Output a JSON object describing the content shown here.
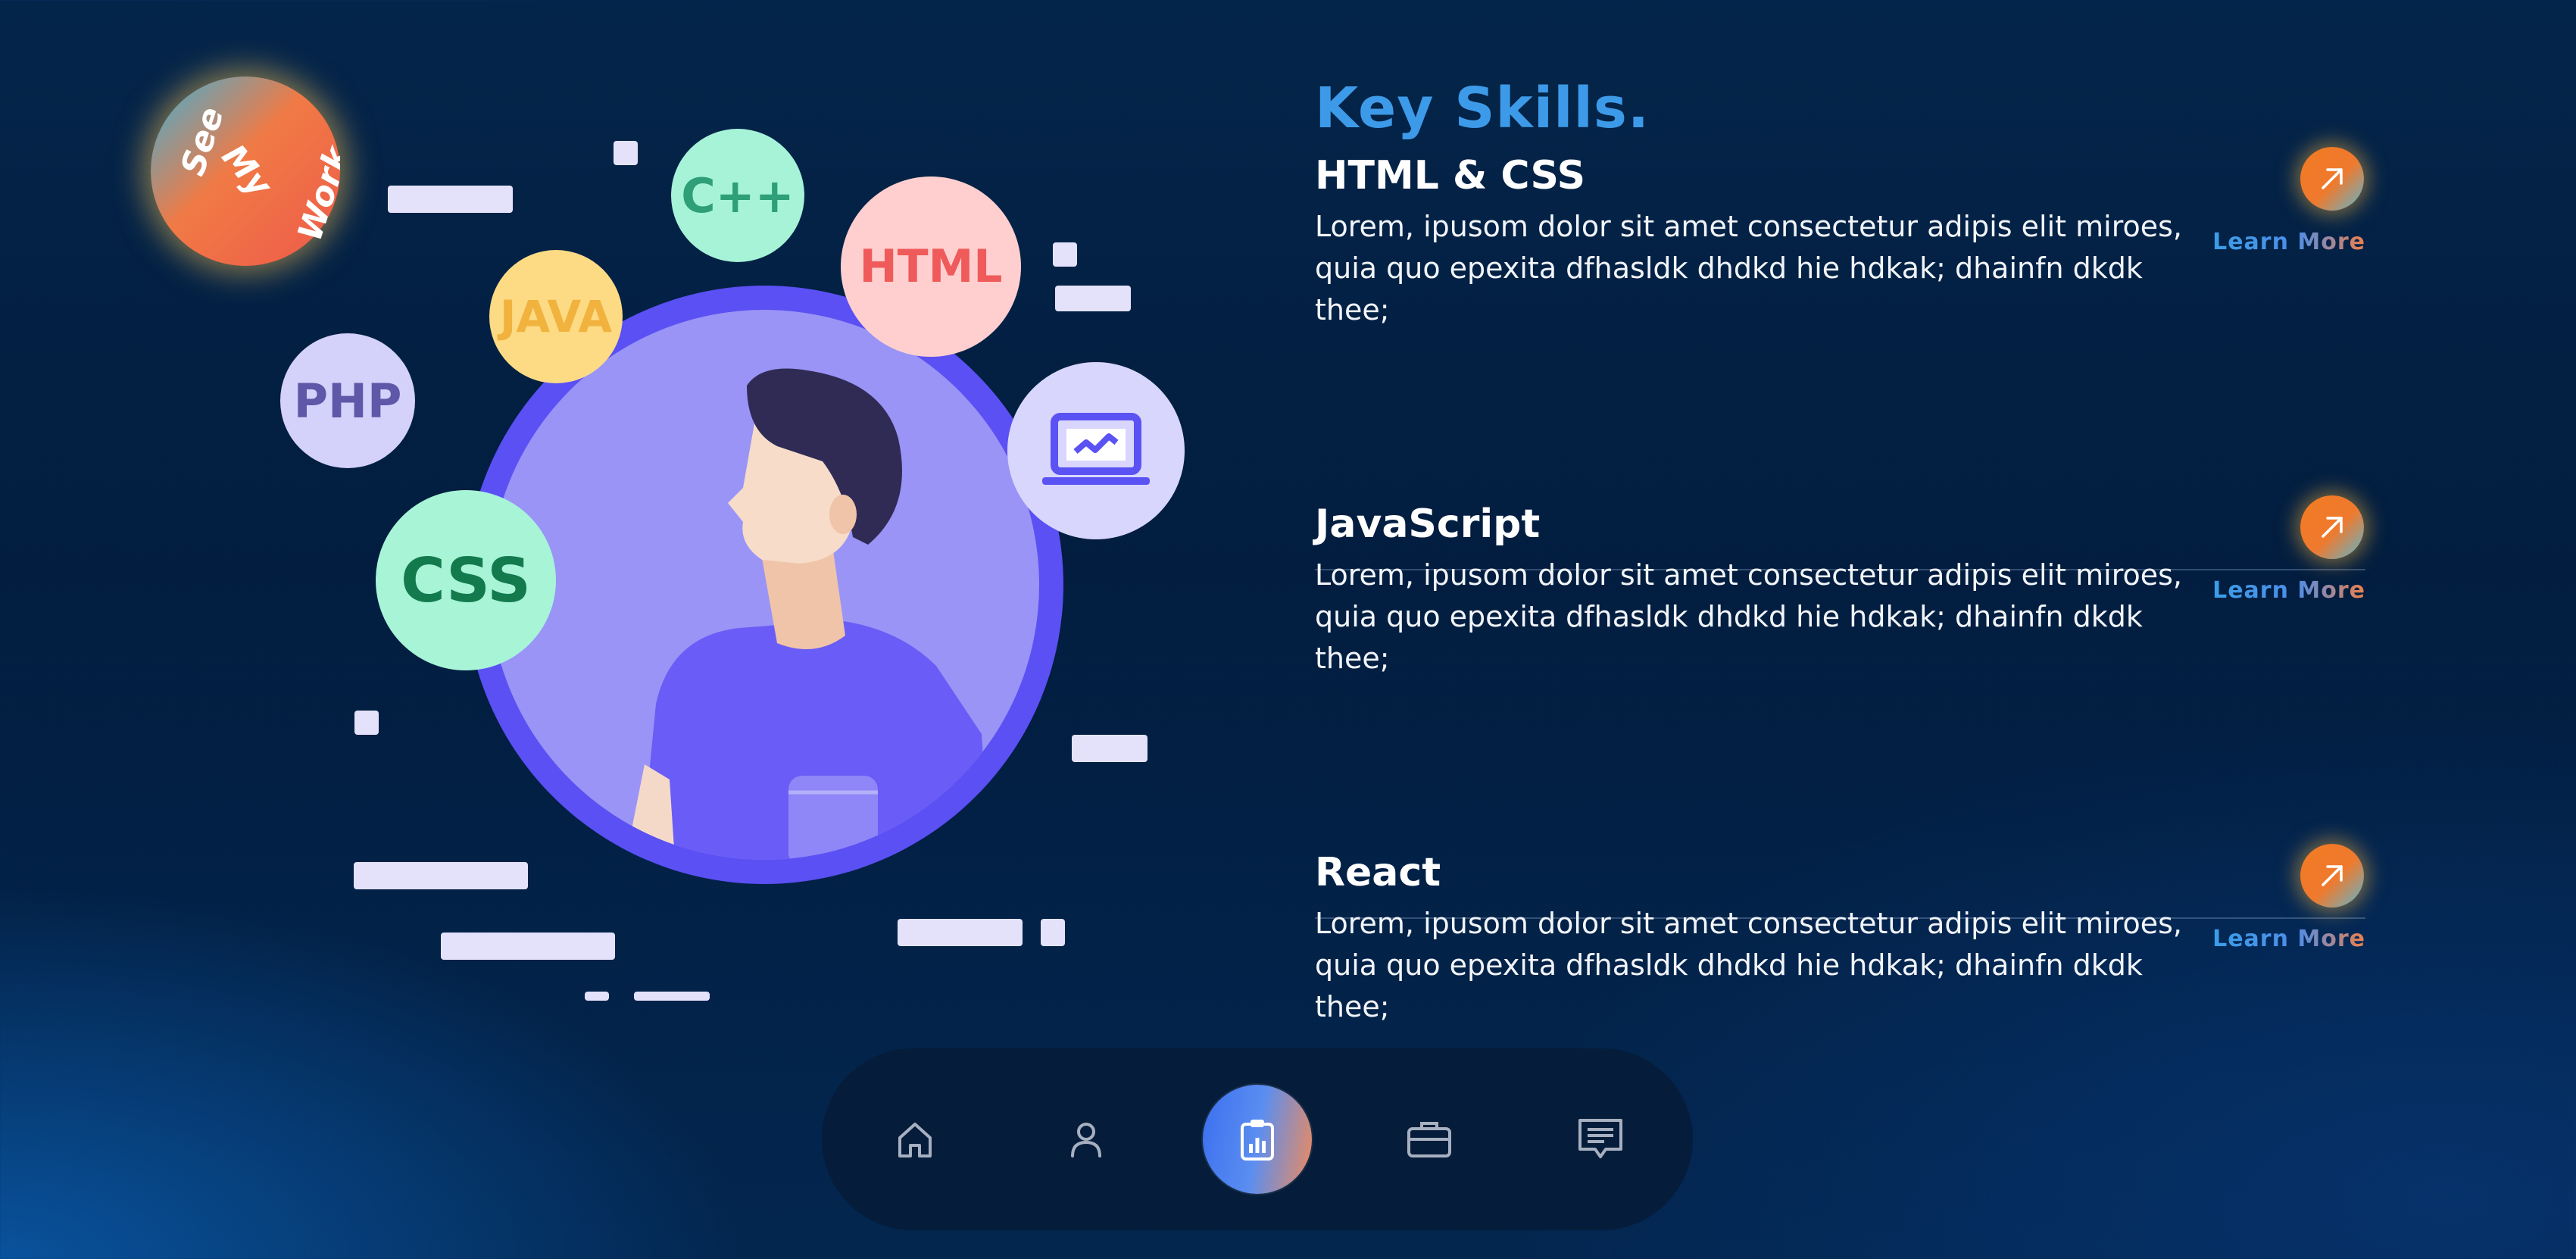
{
  "badge": {
    "lines": [
      "See",
      "My",
      "Work"
    ]
  },
  "illustration": {
    "bubbles": {
      "cpp": "C++",
      "html": "HTML",
      "java": "JAVA",
      "php": "PHP",
      "css": "CSS"
    }
  },
  "skills": {
    "title": "Key Skills.",
    "items": [
      {
        "name": "HTML & CSS",
        "description": "Lorem, ipusom dolor sit amet consectetur adipis elit miroes, quia quo epexita dfhasldk dhdkd hie hdkak; dhainfn dkdk thee;",
        "link_label": "Learn More"
      },
      {
        "name": "JavaScript",
        "description": "Lorem, ipusom dolor sit amet consectetur adipis elit miroes, quia quo epexita dfhasldk dhdkd hie hdkak; dhainfn dkdk thee;",
        "link_label": "Learn More"
      },
      {
        "name": "React",
        "description": "Lorem, ipusom dolor sit amet consectetur adipis elit miroes, quia quo epexita dfhasldk dhdkd hie hdkak; dhainfn dkdk thee;",
        "link_label": "Learn More"
      }
    ]
  },
  "nav": {
    "items": [
      {
        "icon": "home-icon",
        "active": false
      },
      {
        "icon": "user-icon",
        "active": false
      },
      {
        "icon": "skills-clipboard-chart-icon",
        "active": true
      },
      {
        "icon": "briefcase-icon",
        "active": false
      },
      {
        "icon": "message-icon",
        "active": false
      }
    ]
  },
  "colors": {
    "background": "#021d3f",
    "title_accent": "#3d9ae8",
    "button_orange": "#f27b22",
    "avatar_ring": "#5a50f3"
  }
}
